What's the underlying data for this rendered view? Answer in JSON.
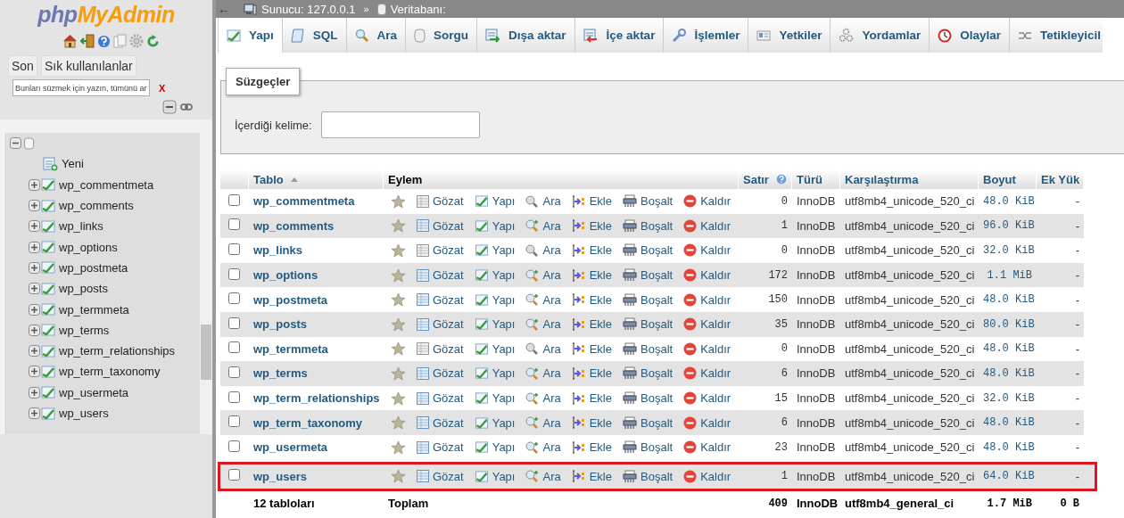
{
  "sidebar": {
    "logo_prefix": "php",
    "logo_suffix": "MyAdmin",
    "buttons": [
      "Son",
      "Sık kullanılanlar"
    ],
    "filter": {
      "placeholder": "Bunları süzmek için yazın, tümünü ar",
      "clear": "X"
    },
    "tree": {
      "expanded": true,
      "children": [
        {
          "kind": "new",
          "label": "Yeni"
        },
        {
          "kind": "table",
          "label": "wp_commentmeta",
          "expanded": false
        },
        {
          "kind": "table",
          "label": "wp_comments",
          "expanded": false
        },
        {
          "kind": "table",
          "label": "wp_links",
          "expanded": false
        },
        {
          "kind": "table",
          "label": "wp_options",
          "expanded": false
        },
        {
          "kind": "table",
          "label": "wp_postmeta",
          "expanded": false
        },
        {
          "kind": "table",
          "label": "wp_posts",
          "expanded": false
        },
        {
          "kind": "table",
          "label": "wp_termmeta",
          "expanded": false
        },
        {
          "kind": "table",
          "label": "wp_terms",
          "expanded": false
        },
        {
          "kind": "table",
          "label": "wp_term_relationships",
          "expanded": false
        },
        {
          "kind": "table",
          "label": "wp_term_taxonomy",
          "expanded": false
        },
        {
          "kind": "table",
          "label": "wp_usermeta",
          "expanded": false
        },
        {
          "kind": "table",
          "label": "wp_users",
          "expanded": false
        }
      ]
    }
  },
  "breadcrumb": {
    "back": "←",
    "server": "Sunucu: 127.0.0.1",
    "separator": "»",
    "database": "Veritabanı:"
  },
  "tabs": [
    {
      "label": "Yapı",
      "selected": true
    },
    {
      "label": "SQL",
      "selected": false
    },
    {
      "label": "Ara",
      "selected": false
    },
    {
      "label": "Sorgu",
      "selected": false
    },
    {
      "label": "Dışa aktar",
      "selected": false
    },
    {
      "label": "İçe aktar",
      "selected": false
    },
    {
      "label": "İşlemler",
      "selected": false
    },
    {
      "label": "Yetkiler",
      "selected": false
    },
    {
      "label": "Yordamlar",
      "selected": false
    },
    {
      "label": "Olaylar",
      "selected": false
    },
    {
      "label": "Tetikleyicil",
      "selected": false
    }
  ],
  "filters": {
    "legend": "Süzgeçler",
    "label": "İçerdiği kelime:"
  },
  "table": {
    "columns": [
      "Tablo",
      "Eylem",
      "Satır",
      "Türü",
      "Karşılaştırma",
      "Boyut",
      "Ek Yük"
    ],
    "rows": [
      {
        "name": "wp_commentmeta",
        "checked": false,
        "empty": true,
        "highlighted": false,
        "actions": [
          "Gözat",
          "Yapı",
          "Ara",
          "Ekle",
          "Boşalt",
          "Kaldır"
        ],
        "rows": "0",
        "type": "InnoDB",
        "collation": "utf8mb4_unicode_520_ci",
        "size": "48.0 KiB",
        "overhead": "-"
      },
      {
        "name": "wp_comments",
        "checked": false,
        "empty": false,
        "highlighted": false,
        "actions": [
          "Gözat",
          "Yapı",
          "Ara",
          "Ekle",
          "Boşalt",
          "Kaldır"
        ],
        "rows": "1",
        "type": "InnoDB",
        "collation": "utf8mb4_unicode_520_ci",
        "size": "96.0 KiB",
        "overhead": "-"
      },
      {
        "name": "wp_links",
        "checked": false,
        "empty": true,
        "highlighted": false,
        "actions": [
          "Gözat",
          "Yapı",
          "Ara",
          "Ekle",
          "Boşalt",
          "Kaldır"
        ],
        "rows": "0",
        "type": "InnoDB",
        "collation": "utf8mb4_unicode_520_ci",
        "size": "32.0 KiB",
        "overhead": "-"
      },
      {
        "name": "wp_options",
        "checked": false,
        "empty": false,
        "highlighted": false,
        "actions": [
          "Gözat",
          "Yapı",
          "Ara",
          "Ekle",
          "Boşalt",
          "Kaldır"
        ],
        "rows": "172",
        "type": "InnoDB",
        "collation": "utf8mb4_unicode_520_ci",
        "size": "1.1 MiB",
        "overhead": "-"
      },
      {
        "name": "wp_postmeta",
        "checked": false,
        "empty": false,
        "highlighted": false,
        "actions": [
          "Gözat",
          "Yapı",
          "Ara",
          "Ekle",
          "Boşalt",
          "Kaldır"
        ],
        "rows": "150",
        "type": "InnoDB",
        "collation": "utf8mb4_unicode_520_ci",
        "size": "48.0 KiB",
        "overhead": "-"
      },
      {
        "name": "wp_posts",
        "checked": false,
        "empty": false,
        "highlighted": false,
        "actions": [
          "Gözat",
          "Yapı",
          "Ara",
          "Ekle",
          "Boşalt",
          "Kaldır"
        ],
        "rows": "35",
        "type": "InnoDB",
        "collation": "utf8mb4_unicode_520_ci",
        "size": "80.0 KiB",
        "overhead": "-"
      },
      {
        "name": "wp_termmeta",
        "checked": false,
        "empty": true,
        "highlighted": false,
        "actions": [
          "Gözat",
          "Yapı",
          "Ara",
          "Ekle",
          "Boşalt",
          "Kaldır"
        ],
        "rows": "0",
        "type": "InnoDB",
        "collation": "utf8mb4_unicode_520_ci",
        "size": "48.0 KiB",
        "overhead": "-"
      },
      {
        "name": "wp_terms",
        "checked": false,
        "empty": false,
        "highlighted": false,
        "actions": [
          "Gözat",
          "Yapı",
          "Ara",
          "Ekle",
          "Boşalt",
          "Kaldır"
        ],
        "rows": "6",
        "type": "InnoDB",
        "collation": "utf8mb4_unicode_520_ci",
        "size": "48.0 KiB",
        "overhead": "-"
      },
      {
        "name": "wp_term_relationships",
        "checked": false,
        "empty": false,
        "highlighted": false,
        "actions": [
          "Gözat",
          "Yapı",
          "Ara",
          "Ekle",
          "Boşalt",
          "Kaldır"
        ],
        "rows": "15",
        "type": "InnoDB",
        "collation": "utf8mb4_unicode_520_ci",
        "size": "32.0 KiB",
        "overhead": "-"
      },
      {
        "name": "wp_term_taxonomy",
        "checked": false,
        "empty": false,
        "highlighted": false,
        "actions": [
          "Gözat",
          "Yapı",
          "Ara",
          "Ekle",
          "Boşalt",
          "Kaldır"
        ],
        "rows": "6",
        "type": "InnoDB",
        "collation": "utf8mb4_unicode_520_ci",
        "size": "48.0 KiB",
        "overhead": "-"
      },
      {
        "name": "wp_usermeta",
        "checked": false,
        "empty": false,
        "highlighted": false,
        "actions": [
          "Gözat",
          "Yapı",
          "Ara",
          "Ekle",
          "Boşalt",
          "Kaldır"
        ],
        "rows": "23",
        "type": "InnoDB",
        "collation": "utf8mb4_unicode_520_ci",
        "size": "48.0 KiB",
        "overhead": "-"
      },
      {
        "name": "wp_users",
        "checked": false,
        "empty": false,
        "highlighted": true,
        "actions": [
          "Gözat",
          "Yapı",
          "Ara",
          "Ekle",
          "Boşalt",
          "Kaldır"
        ],
        "rows": "1",
        "type": "InnoDB",
        "collation": "utf8mb4_unicode_520_ci",
        "size": "64.0 KiB",
        "overhead": "-"
      }
    ],
    "footer": {
      "count": "12 tabloları",
      "label": "Toplam",
      "rows": "409",
      "type": "InnoDB",
      "collation": "utf8mb4_general_ci",
      "size": "1.7 MiB",
      "overhead": "0 B"
    }
  }
}
